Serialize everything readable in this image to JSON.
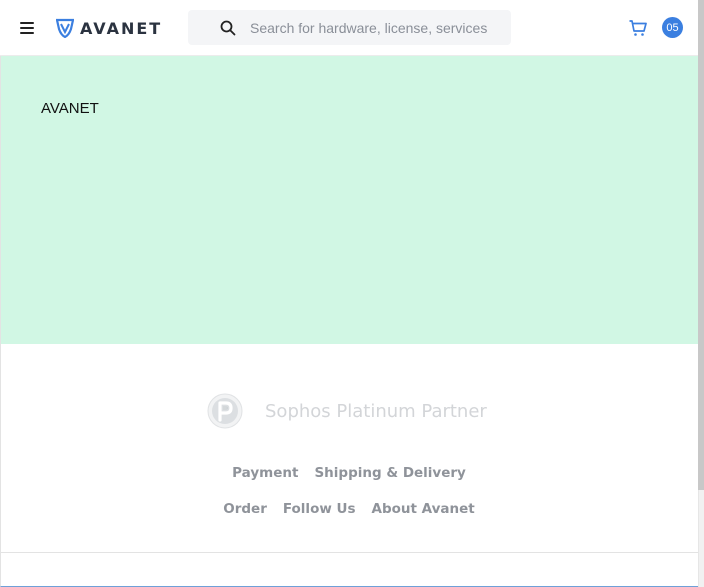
{
  "header": {
    "brand": "AVANET",
    "search_placeholder": "Search for hardware, license, services",
    "cart_count": "05",
    "accent_color": "#3b7fe0",
    "icons": [
      "menu-icon",
      "avanet-logo",
      "search-icon",
      "cart-icon"
    ]
  },
  "hero": {
    "text": "AVANET",
    "background": "#d1f7e4"
  },
  "footer": {
    "partner_text": "Sophos Platinum Partner",
    "links_row1": [
      "Payment",
      "Shipping & Delivery"
    ],
    "links_row2": [
      "Order",
      "Follow Us",
      "About Avanet"
    ]
  }
}
